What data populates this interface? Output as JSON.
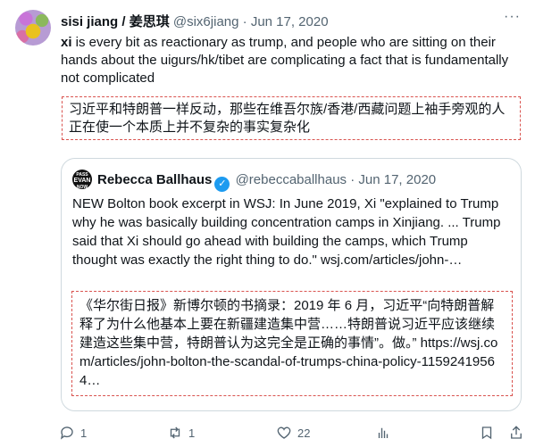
{
  "tweet": {
    "author_name": "sisi jiang / 姜思琪",
    "author_handle": "@six6jiang",
    "separator": "·",
    "date": "Jun 17, 2020",
    "more_label": "···",
    "text_bold": "xi",
    "text_rest": " is every bit as reactionary as trump, and people who are sitting on their hands about the uigurs/hk/tibet are complicating a fact that is fundamentally not complicated",
    "translation": "习近平和特朗普一样反动，那些在维吾尔族/香港/西藏问题上袖手旁观的人正在使一个本质上并不复杂的事实复杂化"
  },
  "quoted": {
    "avatar_text_top": "PASS",
    "avatar_text_mid": "EVAN",
    "avatar_text_bottom": "NOW",
    "author_name": "Rebecca Ballhaus",
    "verified_mark": "✓",
    "author_handle": "@rebeccaballhaus",
    "separator": "·",
    "date": "Jun 17, 2020",
    "text": "NEW Bolton book excerpt in WSJ: In June 2019, Xi \"explained to Trump why he was basically building concentration camps in Xinjiang. ... Trump said that Xi should go ahead with building the camps, which Trump thought was exactly the right thing to do.\" wsj.com/articles/john-…",
    "translation": "《华尔街日报》新博尔顿的书摘录：2019 年 6 月，习近平“向特朗普解释了为什么他基本上要在新疆建造集中营……特朗普说习近平应该继续建造这些集中营，特朗普认为这完全是正确的事情”。做。” https://wsj.com/articles/john-bolton-the-scandal-of-trumps-china-policy-11592419564…"
  },
  "actions": {
    "reply_count": "1",
    "retweet_count": "1",
    "like_count": "22"
  },
  "colors": {
    "text": "#0f1419",
    "muted": "#536471",
    "border": "#cfd9de",
    "dashed_box": "#d9534f",
    "verified": "#1d9bf0"
  }
}
